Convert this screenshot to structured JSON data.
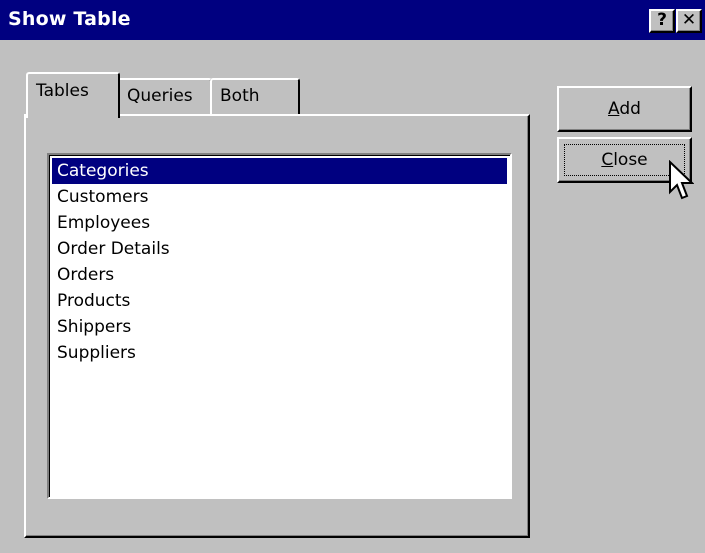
{
  "window": {
    "title": "Show Table",
    "help_glyph": "?",
    "close_glyph": "✕"
  },
  "tabs": [
    {
      "label": "Tables",
      "active": true
    },
    {
      "label": "Queries",
      "active": false
    },
    {
      "label": "Both",
      "active": false
    }
  ],
  "list": {
    "items": [
      "Categories",
      "Customers",
      "Employees",
      "Order Details",
      "Orders",
      "Products",
      "Shippers",
      "Suppliers"
    ],
    "selected_item": "Categories"
  },
  "buttons": {
    "add": {
      "mnemonic": "A",
      "rest": "dd"
    },
    "close": {
      "mnemonic": "C",
      "rest": "lose"
    }
  },
  "colors": {
    "titlebar": "#000080",
    "face": "#c0c0c0",
    "selection": "#000080"
  },
  "icons": {
    "cursor": "mouse-pointer-icon"
  }
}
